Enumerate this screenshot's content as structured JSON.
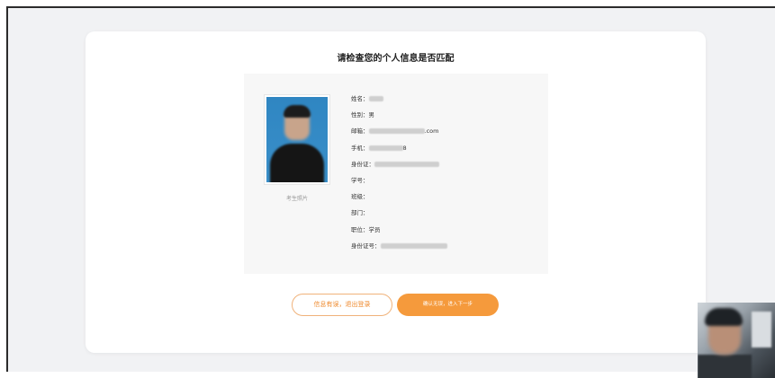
{
  "page": {
    "title": "请检查您的个人信息是否匹配"
  },
  "profile": {
    "photo_caption": "考生照片",
    "fields": [
      {
        "label": "姓名：",
        "value": "",
        "redacted": true
      },
      {
        "label": "性别：",
        "value": "男",
        "redacted": false
      },
      {
        "label": "邮箱：",
        "value": ".com",
        "redacted": true
      },
      {
        "label": "手机：",
        "value": "8",
        "redacted": true
      },
      {
        "label": "身份证：",
        "value": "",
        "redacted": true
      },
      {
        "label": "学号：",
        "value": "",
        "redacted": false
      },
      {
        "label": "班级：",
        "value": "",
        "redacted": false
      },
      {
        "label": "部门：",
        "value": "",
        "redacted": false
      },
      {
        "label": "职位：",
        "value": "学员",
        "redacted": false
      },
      {
        "label": "身份证号：",
        "value": "",
        "redacted": true
      }
    ]
  },
  "actions": {
    "reject_label": "信息有误，退出登录",
    "confirm_label": "确认无误，进入下一步"
  },
  "colors": {
    "accent": "#f59a3c",
    "accent_text": "#ef8a2e",
    "background": "#f1f2f4",
    "card": "#ffffff"
  }
}
